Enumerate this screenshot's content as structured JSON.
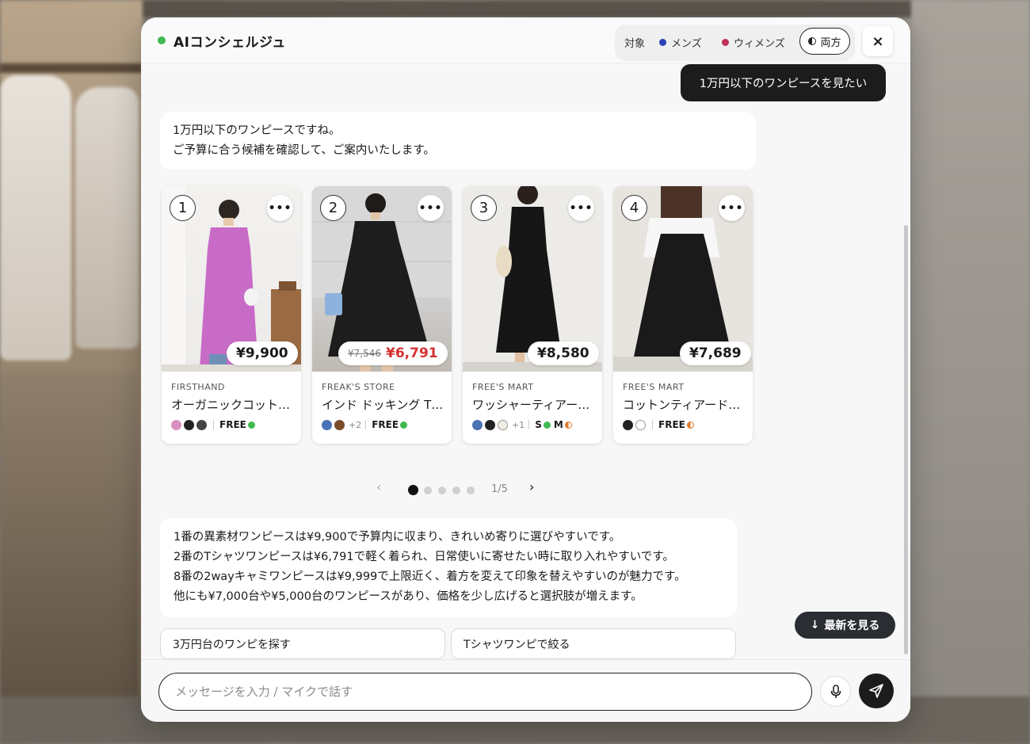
{
  "header": {
    "title": "AIコンシェルジュ",
    "target_label": "対象",
    "options": [
      {
        "label": "メンズ",
        "color": "#2b3fb8"
      },
      {
        "label": "ウィメンズ",
        "color": "#c2325b"
      },
      {
        "label": "両方",
        "selected": true
      }
    ],
    "close_label": "×"
  },
  "chat": {
    "user_message": "1万円以下のワンピースを見たい",
    "ai_message_1": {
      "line1": "1万円以下のワンピースですね。",
      "line2": "ご予算に合う候補を確認して、ご案内いたします。"
    },
    "products": [
      {
        "num": "1",
        "price": "¥9,900",
        "old_price": "",
        "brand": "FIRSTHAND",
        "name": "オーガニックコット…",
        "swatches": [
          "#d98fc0",
          "#222222",
          "#444444"
        ],
        "extra": "",
        "sizes": [
          "FREE"
        ]
      },
      {
        "num": "2",
        "price": "¥6,791",
        "old_price": "¥7,546",
        "brand": "FREAK'S STORE",
        "name": "インド ドッキング T…",
        "swatches": [
          "#4a72b5",
          "#7a4b2a"
        ],
        "extra": "+2",
        "sizes": [
          "FREE"
        ]
      },
      {
        "num": "3",
        "price": "¥8,580",
        "old_price": "",
        "brand": "FREE'S MART",
        "name": "ワッシャーティアー…",
        "swatches": [
          "#4a72b5",
          "#222222",
          "#f2ede4"
        ],
        "extra": "+1",
        "sizes": [
          "S",
          "M"
        ]
      },
      {
        "num": "4",
        "price": "¥7,689",
        "old_price": "",
        "brand": "FREE'S MART",
        "name": "コットンティアード…",
        "swatches": [
          "#222222",
          "#ffffff"
        ],
        "extra": "",
        "sizes": [
          "FREE"
        ]
      }
    ],
    "pager": {
      "prev": "‹",
      "next": "›",
      "count": "1/5",
      "pages": 5,
      "current": 1
    },
    "ai_message_2": {
      "line1": "1番の異素材ワンピースは¥9,900で予算内に収まり、きれいめ寄りに選びやすいです。",
      "line2": "2番のTシャツワンピースは¥6,791で軽く着られ、日常使いに寄せたい時に取り入れやすいです。",
      "line3": "8番の2wayキャミワンピースは¥9,999で上限近く、着方を変えて印象を替えやすいのが魅力です。",
      "line4": "他にも¥7,000台や¥5,000台のワンピースがあり、価格を少し広げると選択肢が増えます。"
    },
    "suggestions": [
      "3万円台のワンピを探す",
      "Tシャツワンピで絞る"
    ],
    "latest_button": "最新を見る"
  },
  "composer": {
    "placeholder": "メッセージを入力 / マイクで話す",
    "value": ""
  },
  "colors": {
    "online": "#3fb950",
    "sale": "#d63030",
    "in_stock": "#3fb950",
    "low_stock": "#e07b2a"
  }
}
